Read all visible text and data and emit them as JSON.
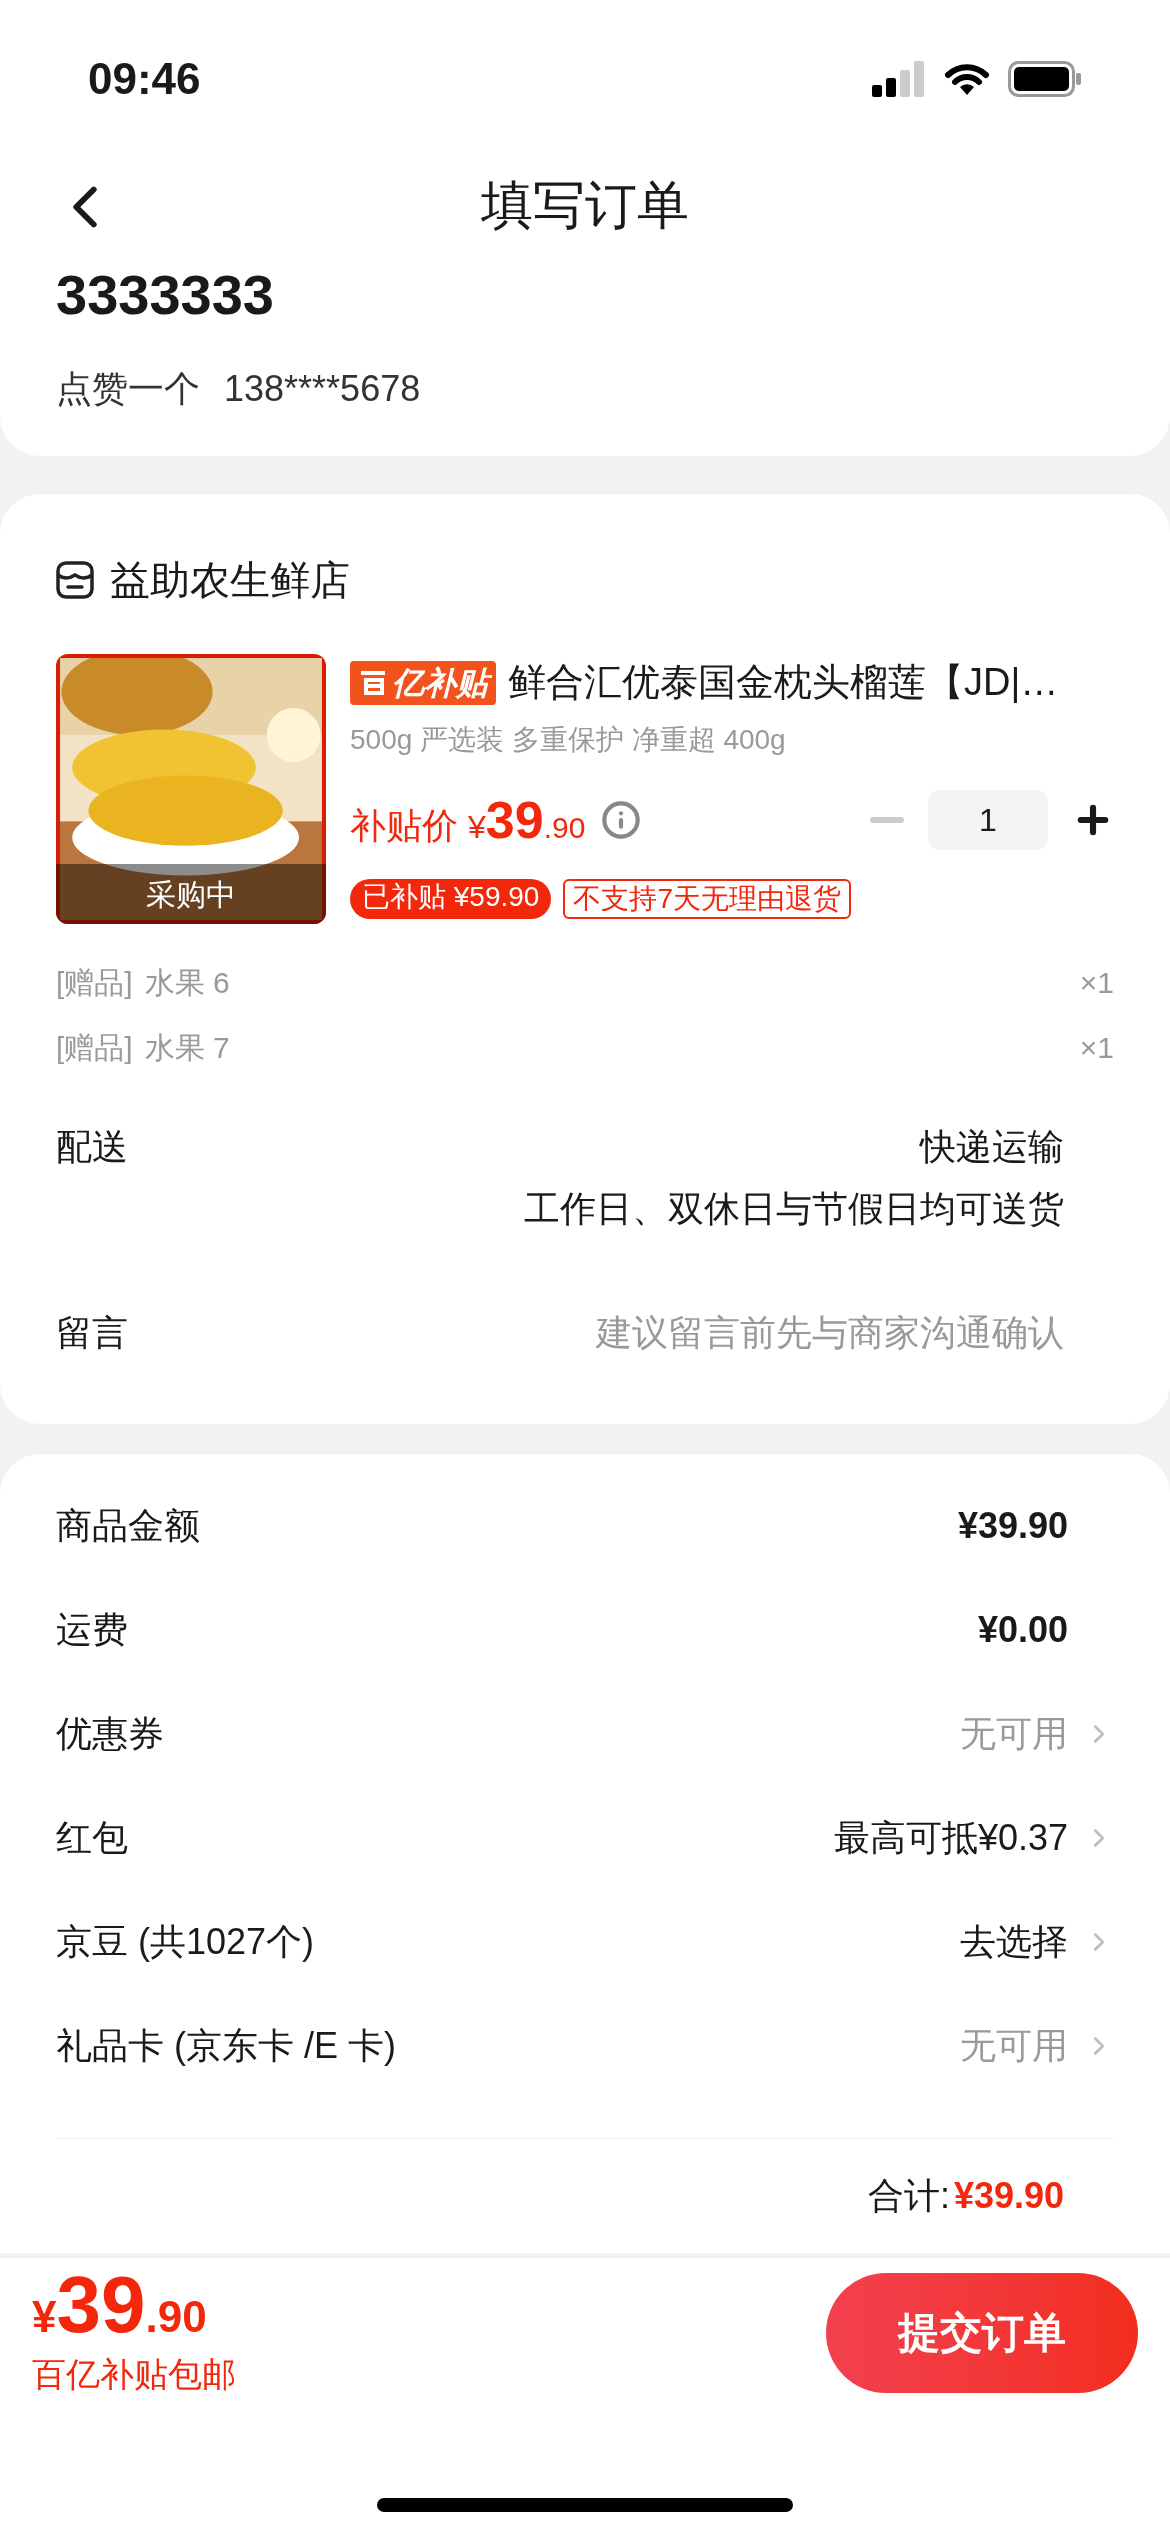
{
  "status_bar": {
    "time": "09:46"
  },
  "header": {
    "title": "填写订单"
  },
  "address": {
    "name": "3333333",
    "contact": "点赞一个",
    "phone": "138****5678"
  },
  "shop": {
    "name": "益助农生鲜店",
    "product": {
      "overlay": "采购中",
      "badge": "亿补贴",
      "title": "鲜合汇优泰国金枕头榴莲【JD|…",
      "spec": "500g 严选装 多重保护 净重超 400g",
      "price_label": "补贴价",
      "currency": "¥",
      "price_int": "39",
      "price_dec": ".90",
      "quantity": "1",
      "minus_disabled": true,
      "tags": [
        {
          "text": "已补贴 ¥59.90",
          "kind": "filled"
        },
        {
          "text": "不支持7天无理由退货",
          "kind": "outline"
        }
      ]
    },
    "gifts": [
      {
        "label": "[赠品]",
        "name": "水果 6",
        "count": "×1"
      },
      {
        "label": "[赠品]",
        "name": "水果 7",
        "count": "×1"
      }
    ],
    "delivery": {
      "label": "配送",
      "method": "快递运输",
      "note": "工作日、双休日与节假日均可送货"
    },
    "message": {
      "label": "留言",
      "placeholder": "建议留言前先与商家沟通确认"
    }
  },
  "summary": {
    "rows": [
      {
        "label": "商品金额",
        "value": "¥39.90",
        "kind": "amount",
        "arrow": false
      },
      {
        "label": "运费",
        "value": "¥0.00",
        "kind": "amount",
        "arrow": false
      },
      {
        "label": "优惠券",
        "value": "无可用",
        "kind": "muted",
        "arrow": true
      },
      {
        "label": "红包",
        "value": "最高可抵¥0.37",
        "kind": "normal",
        "arrow": true
      },
      {
        "label": "京豆 (共1027个)",
        "value": "去选择",
        "kind": "normal",
        "arrow": true
      },
      {
        "label": "礼品卡 (京东卡 /E 卡)",
        "value": "无可用",
        "kind": "muted",
        "arrow": true
      }
    ],
    "total_label": "合计:",
    "total_value": "¥39.90"
  },
  "footer": {
    "currency": "¥",
    "price_int": "39",
    "price_dec": ".90",
    "note": "百亿补贴包邮",
    "submit": "提交订单"
  }
}
